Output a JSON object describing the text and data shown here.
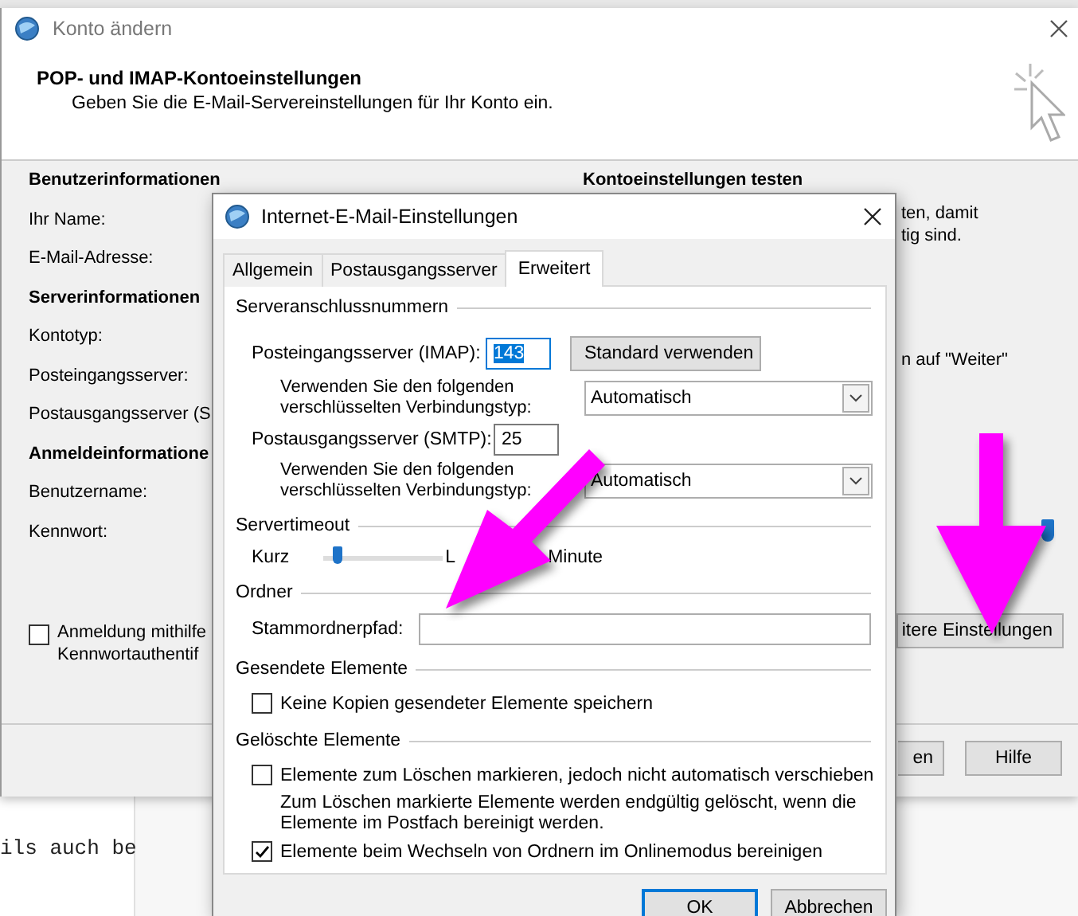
{
  "window": {
    "title": "Konto ändern",
    "heading": "POP- und IMAP-Kontoeinstellungen",
    "subheading": "Geben Sie die E-Mail-Servereinstellungen für Ihr Konto ein.",
    "sections": [
      {
        "title": "Benutzerinformationen",
        "labels": [
          "Ihr Name:",
          "E-Mail-Adresse:"
        ]
      },
      {
        "title": "Serverinformationen",
        "labels": [
          "Kontotyp:",
          "Posteingangsserver:",
          "Postausgangsserver (S"
        ]
      },
      {
        "title": "Anmeldeinformatione",
        "labels": [
          "Benutzername:",
          "Kennwort:"
        ]
      }
    ],
    "spa_checkbox": {
      "lines": [
        "Anmeldung mithilfe",
        "Kennwortauthentif"
      ],
      "checked": false
    },
    "test_section": {
      "title": "Kontoeinstellungen testen",
      "text_1": [
        "ten, damit",
        "tig sind."
      ],
      "text_2": "n auf \"Weiter\"",
      "slider": {
        "level": 1
      },
      "more_settings_button": "itere Einstellungen"
    },
    "buttons": [
      "en",
      "Hilfe"
    ]
  },
  "editor": {
    "lines": [
      "ils auch be"
    ]
  },
  "dialog": {
    "title": "Internet-E-Mail-Einstellungen",
    "tabs": [
      {
        "label": "Allgemein",
        "selected": false
      },
      {
        "label": "Postausgangsserver",
        "selected": false
      },
      {
        "label": "Erweitert",
        "selected": true
      }
    ],
    "server_ports": {
      "title": "Serveranschlussnummern",
      "incoming_label": "Posteingangsserver (IMAP):",
      "incoming_value": "143",
      "incoming_selected": true,
      "default_button": "Standard verwenden",
      "incoming_encryption_label": [
        "Verwenden Sie den folgenden",
        "verschlüsselten Verbindungstyp:"
      ],
      "incoming_encryption": "Automatisch",
      "outgoing_label": "Postausgangsserver (SMTP):",
      "outgoing_value": "25",
      "outgoing_encryption_label": [
        "Verwenden Sie den folgenden",
        "verschlüsselten Verbindungstyp:"
      ],
      "outgoing_encryption": "Automatisch"
    },
    "server_timeout": {
      "title": "Servertimeout",
      "min_label": "Kurz",
      "level": 0.12,
      "max_label": "L",
      "value": "Minute"
    },
    "folders": {
      "title": "Ordner",
      "root_label": "Stammordnerpfad:"
    },
    "sent_items": {
      "title": "Gesendete Elemente",
      "checkboxes": [
        {
          "label": "Keine Kopien gesendeter Elemente speichern",
          "checked": false
        }
      ]
    },
    "deleted_items": {
      "title": "Gelöschte Elemente",
      "checkboxes": [
        {
          "label": "Elemente zum Löschen markieren, jedoch nicht automatisch verschieben",
          "checked": false,
          "note": [
            "Zum Löschen markierte Elemente werden endgültig gelöscht, wenn die",
            "Elemente im Postfach bereinigt werden."
          ]
        },
        {
          "label": "Elemente beim Wechseln von Ordnern im Onlinemodus bereinigen",
          "checked": true
        }
      ]
    },
    "buttons": [
      {
        "label": "OK",
        "default": true
      },
      {
        "label": "Abbrechen",
        "default": false
      }
    ]
  }
}
